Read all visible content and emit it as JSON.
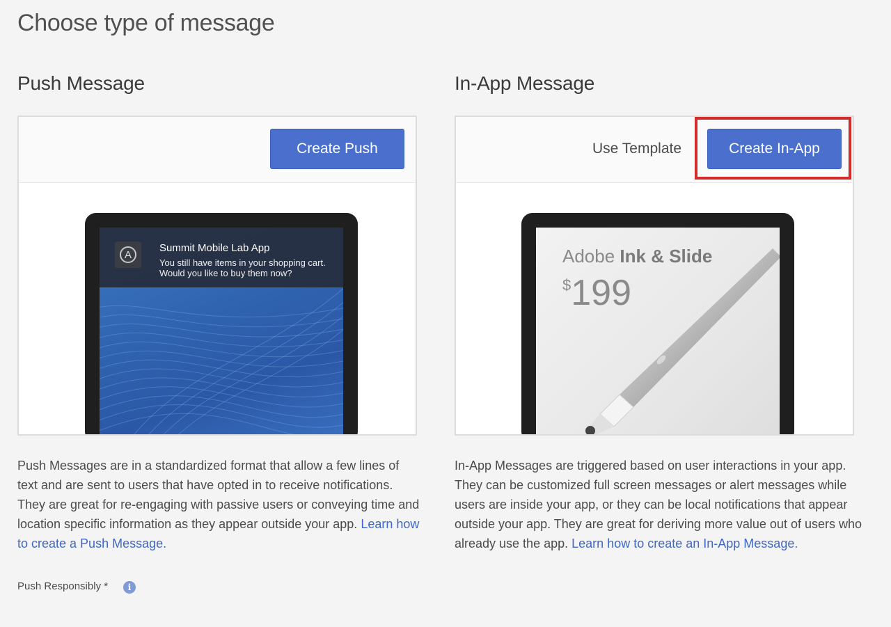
{
  "page": {
    "title": "Choose type of message"
  },
  "push": {
    "title": "Push Message",
    "create_button": "Create Push",
    "notification": {
      "app_icon_letter": "A",
      "title": "Summit Mobile Lab App",
      "body": "You still have items in your shopping cart. Would you like to buy them now?"
    },
    "description": "Push Messages are in a standardized format that allow a few lines of text and are sent to users that have opted in to receive notifications. They are great for re-engaging with passive users or conveying time and location specific information as they appear outside your app.",
    "learn_link": "Learn how to create a Push Message.",
    "responsibly_label": "Push Responsibly *",
    "info_icon": "i"
  },
  "inapp": {
    "title": "In-App Message",
    "template_button": "Use Template",
    "create_button": "Create In-App",
    "ad": {
      "brand": "Adobe",
      "product_name": "Ink & Slide",
      "currency": "$",
      "price": "199"
    },
    "description": "In-App Messages are triggered based on user interactions in your app. They can be customized full screen messages or alert messages while users are inside your app, or they can be local notifications that appear outside your app. They are great for deriving more value out of users who already use the app.",
    "learn_link": "Learn how to create an In-App Message."
  },
  "colors": {
    "primary_button": "#4a6fcd",
    "link": "#3f67c8",
    "highlight": "#d52b2b"
  }
}
